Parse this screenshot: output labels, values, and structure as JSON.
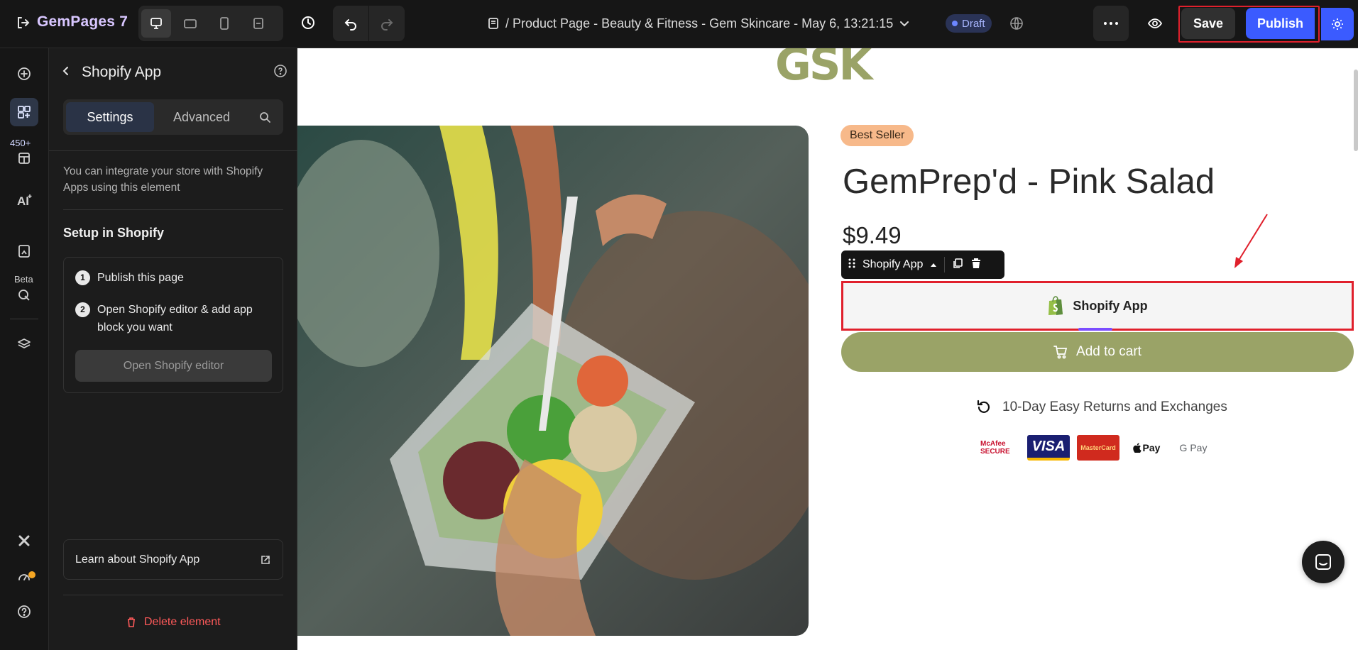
{
  "app": {
    "logo_text": "GemPages 7"
  },
  "topbar": {
    "page_title": "/ Product Page - Beauty & Fitness - Gem Skincare - May 6, 13:21:15",
    "status_badge": "Draft",
    "save_label": "Save",
    "publish_label": "Publish",
    "device_modes": [
      "desktop",
      "tablet-landscape",
      "mobile",
      "responsive"
    ],
    "active_device": "desktop"
  },
  "rail": {
    "badge_count": "450+",
    "beta_label": "Beta",
    "items": [
      "add-icon",
      "elements-icon",
      "sections-icon",
      "ai-icon",
      "pages-icon",
      "cursor-icon",
      "layers-icon",
      "x-icon",
      "speed-icon",
      "help-icon"
    ]
  },
  "panel": {
    "title": "Shopify App",
    "tabs": [
      "Settings",
      "Advanced"
    ],
    "active_tab": "Settings",
    "description": "You can integrate your store with Shopify Apps using this element",
    "setup_title": "Setup in Shopify",
    "steps": [
      {
        "num": "1",
        "text": "Publish this page"
      },
      {
        "num": "2",
        "text": "Open Shopify editor & add app block you want"
      }
    ],
    "open_editor_label": "Open Shopify editor",
    "learn_label": "Learn about Shopify App",
    "delete_label": "Delete element"
  },
  "canvas": {
    "brand": "GSK",
    "badge": "Best Seller",
    "product_name": "GemPrep'd - Pink Salad",
    "price": "$9.49",
    "toolbar_label": "Shopify App",
    "shopify_block_label": "Shopify App",
    "add_to_cart_label": "Add to cart",
    "returns_text": "10-Day Easy Returns and Exchanges",
    "payments": {
      "mcafee": "McAfee SECURE",
      "visa": "VISA",
      "mastercard": "MasterCard",
      "applepay": "Pay",
      "gpay": "G Pay"
    }
  },
  "colors": {
    "accent": "#3b5bff",
    "highlight": "#e0202c",
    "olive": "#9aa367",
    "badge_orange": "#f7b98a"
  }
}
